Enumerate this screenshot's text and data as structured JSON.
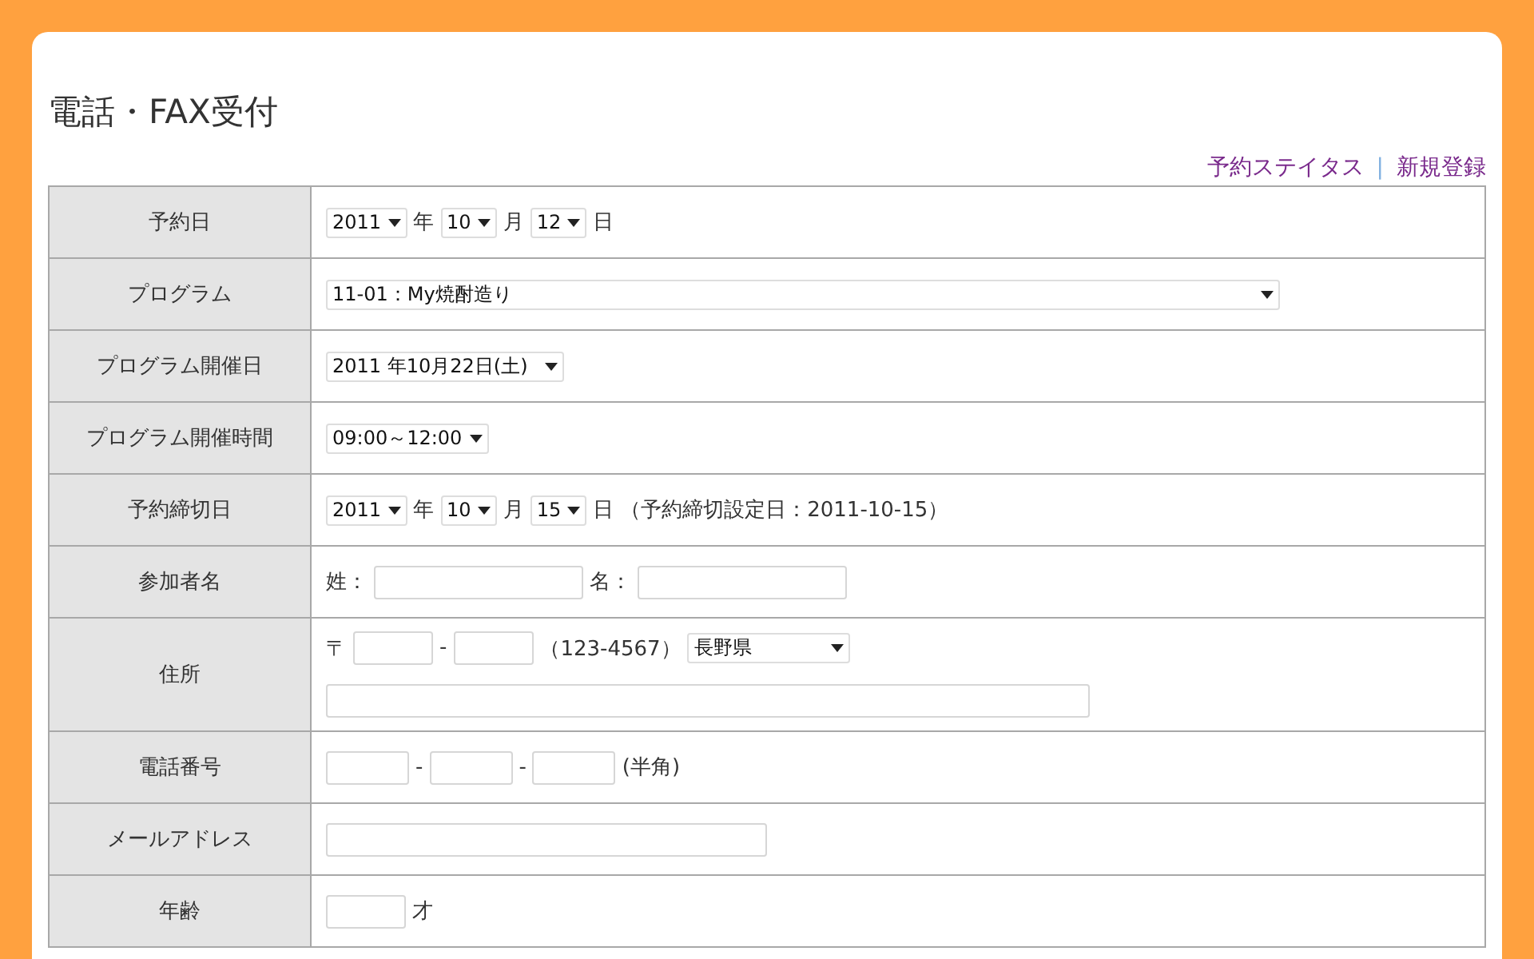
{
  "page": {
    "title": "電話・FAX受付"
  },
  "links": [
    {
      "label": "予約ステイタス"
    },
    {
      "label": "新規登録"
    }
  ],
  "link_separator": "|",
  "rows": [
    {
      "label": "予約日",
      "lines": [
        [
          {
            "kind": "select",
            "value": "2011"
          },
          {
            "kind": "text",
            "text": "年"
          },
          {
            "kind": "select",
            "value": "10"
          },
          {
            "kind": "text",
            "text": "月"
          },
          {
            "kind": "select",
            "value": "12"
          },
          {
            "kind": "text",
            "text": "日"
          }
        ]
      ]
    },
    {
      "label": "プログラム",
      "lines": [
        [
          {
            "kind": "select",
            "value": "11-01：My焼酎造り"
          }
        ]
      ]
    },
    {
      "label": "プログラム開催日",
      "lines": [
        [
          {
            "kind": "select",
            "value": "2011 年10月22日(土)"
          }
        ]
      ]
    },
    {
      "label": "プログラム開催時間",
      "lines": [
        [
          {
            "kind": "select",
            "value": "09:00～12:00"
          }
        ]
      ]
    },
    {
      "label": "予約締切日",
      "lines": [
        [
          {
            "kind": "select",
            "value": "2011"
          },
          {
            "kind": "text",
            "text": "年"
          },
          {
            "kind": "select",
            "value": "10"
          },
          {
            "kind": "text",
            "text": "月"
          },
          {
            "kind": "select",
            "value": "15"
          },
          {
            "kind": "text",
            "text": "日"
          },
          {
            "kind": "text",
            "text": "（予約締切設定日：2011-10-15）"
          }
        ]
      ]
    },
    {
      "label": "参加者名",
      "lines": [
        [
          {
            "kind": "text",
            "text": "姓："
          },
          {
            "kind": "input"
          },
          {
            "kind": "text",
            "text": "名："
          },
          {
            "kind": "input"
          }
        ]
      ]
    },
    {
      "label": "住所",
      "lines": [
        [
          {
            "kind": "text",
            "text": "〒"
          },
          {
            "kind": "input"
          },
          {
            "kind": "text",
            "text": "-"
          },
          {
            "kind": "input"
          },
          {
            "kind": "text",
            "text": "（123-4567）"
          },
          {
            "kind": "select",
            "value": "長野県"
          }
        ],
        [
          {
            "kind": "input"
          }
        ]
      ]
    },
    {
      "label": "電話番号",
      "lines": [
        [
          {
            "kind": "input"
          },
          {
            "kind": "text",
            "text": "-"
          },
          {
            "kind": "input"
          },
          {
            "kind": "text",
            "text": "-"
          },
          {
            "kind": "input"
          },
          {
            "kind": "text",
            "text": "(半角)"
          }
        ]
      ]
    },
    {
      "label": "メールアドレス",
      "lines": [
        [
          {
            "kind": "input"
          }
        ]
      ]
    },
    {
      "label": "年齢",
      "lines": [
        [
          {
            "kind": "input"
          },
          {
            "kind": "text",
            "text": "才"
          }
        ]
      ]
    }
  ]
}
